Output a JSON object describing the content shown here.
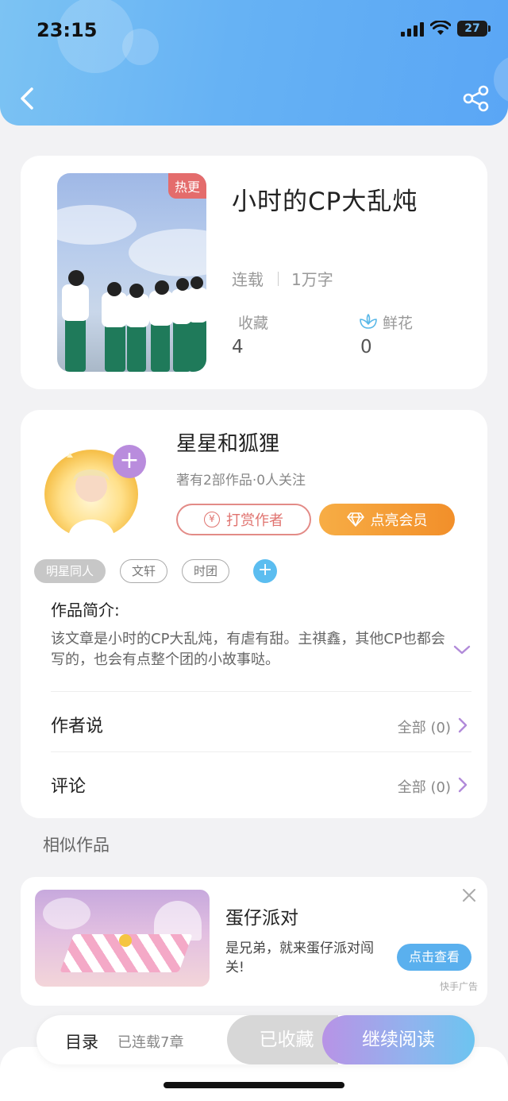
{
  "status_bar": {
    "time": "23:15",
    "battery": "27"
  },
  "header": {
    "back_icon": "chevron-left-icon",
    "share_icon": "share-icon"
  },
  "book": {
    "badge": "热更",
    "title": "小时的CP大乱炖",
    "status": "连载",
    "word_count": "1万字",
    "favorites_label": "收藏",
    "favorites_value": "4",
    "flowers_label": "鲜花",
    "flowers_value": "0"
  },
  "author": {
    "name": "星星和狐狸",
    "meta": "著有2部作品·0人关注",
    "reward_label": "打赏作者",
    "reward_icon_text": "¥",
    "vip_label": "点亮会员",
    "follow_symbol": "+"
  },
  "tags": [
    "明星同人",
    "文轩",
    "时团"
  ],
  "tag_add_symbol": "+",
  "intro": {
    "title": "作品简介:",
    "text": "该文章是小时的CP大乱炖，有虐有甜。主祺鑫，其他CP也都会写的，也会有点整个团的小故事哒。"
  },
  "rows": {
    "author_says": {
      "label": "作者说",
      "value": "全部 (0)"
    },
    "comments": {
      "label": "评论",
      "value": "全部 (0)"
    }
  },
  "similar": {
    "title": "相似作品"
  },
  "ad": {
    "title": "蛋仔派对",
    "desc": "是兄弟，就来蛋仔派对闯关!",
    "button": "点击查看",
    "source": "快手广告"
  },
  "bottom": {
    "toc_label": "目录",
    "toc_count": "已连载7章",
    "collected_label": "已收藏",
    "read_label": "继续阅读"
  },
  "colors": {
    "header": "#66b2f4",
    "hot_badge": "#e46c6c",
    "vip": "#f28f2a",
    "accent_purple": "#b98cdd",
    "ad_button": "#5ab0ee"
  }
}
